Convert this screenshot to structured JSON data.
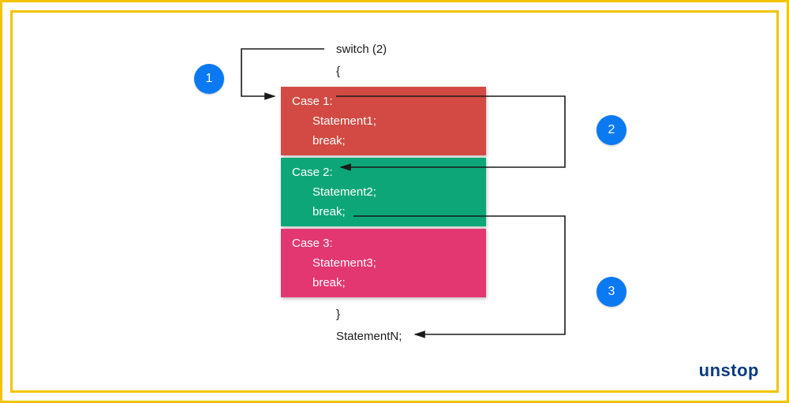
{
  "header": {
    "switch_line": "switch (2)",
    "open_brace": "{",
    "close_brace": "}",
    "footer_statement": "StatementN;"
  },
  "cases": [
    {
      "label": "Case 1:",
      "stmt": "Statement1;",
      "brk": "break;",
      "color": "#D24A43"
    },
    {
      "label": "Case 2:",
      "stmt": "Statement2;",
      "brk": "break;",
      "color": "#0DA678"
    },
    {
      "label": "Case 3:",
      "stmt": "Statement3;",
      "brk": "break;",
      "color": "#E23770"
    }
  ],
  "badges": {
    "one": "1",
    "two": "2",
    "three": "3"
  },
  "logo": {
    "prefix": "un",
    "suffix": "stop"
  }
}
